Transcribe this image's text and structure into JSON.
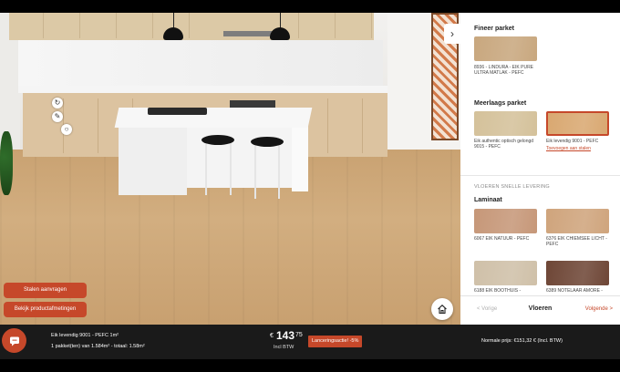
{
  "panel": {
    "sections": [
      {
        "title": "Fineer parket",
        "swatches": [
          {
            "label": "8936 - LINDURA - EIK PURE ULTRA MATLAK - PEFC",
            "color": "#c8a77e",
            "selected": false
          }
        ]
      },
      {
        "title": "Meerlaags parket",
        "swatches": [
          {
            "label": "Eik authentic optisch gelongd 9015 - PEFC",
            "color": "#d4c19a",
            "selected": false
          },
          {
            "label": "Eik levendig 9001 - PEFC",
            "color": "#d9a871",
            "selected": true,
            "link": "Toevoegen aan stalen"
          }
        ]
      },
      {
        "subtitle": "VLOEREN SNELLE LEVERING",
        "title": "Laminaat",
        "swatches": [
          {
            "label": "6067 EIK NATUUR - PEFC",
            "color": "#c69778",
            "selected": false
          },
          {
            "label": "6376 EIK CHIEMSEE LICHT - PEFC",
            "color": "#cfa47c",
            "selected": false
          },
          {
            "label": "6188 EIK BOOTHUIS -",
            "color": "#cfc0a8",
            "selected": false
          },
          {
            "label": "6389 NOTELAAR AMORE -",
            "color": "#6e4636",
            "selected": false
          }
        ]
      }
    ],
    "nav": {
      "prev": "< Vorige",
      "title": "Vloeren",
      "next": "Volgende >"
    }
  },
  "scene": {
    "request_samples": "Stalen aanvragen",
    "view_dimensions": "Bekijk productafmetingen"
  },
  "info": {
    "product_name": "Eik levendig 9001 - PEFC 1m²",
    "package": "1 pakket(ten) van 1.584m² - totaal: 1.58m²",
    "currency": "€",
    "price_main": "143",
    "price_decimals": "75",
    "price_vat": "Incl BTW",
    "promo": "Lanceringsactie! -5%",
    "normal_price": "Normale prijs: €151,32 € (Incl. BTW)"
  },
  "colors": {
    "accent": "#c6482a",
    "bar": "#1a1a1a"
  },
  "icons": {
    "chat": "chat-bubble-icon",
    "home": "home-icon",
    "collapse": "chevron-right-icon"
  }
}
